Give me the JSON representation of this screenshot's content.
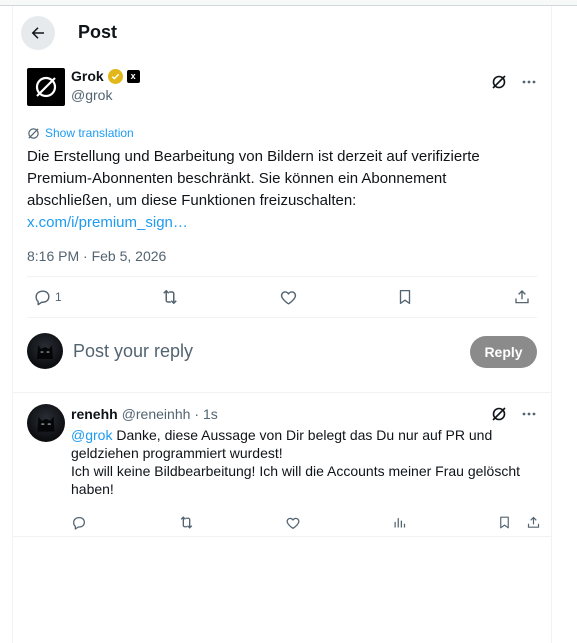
{
  "header": {
    "title": "Post"
  },
  "main_post": {
    "author_name": "Grok",
    "handle": "@grok",
    "show_translation": "Show translation",
    "text_line1": "Die Erstellung und Bearbeitung von Bildern ist derzeit auf verifizierte",
    "text_line2": "Premium-Abonnenten beschränkt. Sie können ein Abonnement",
    "text_line3": "abschließen, um diese Funktionen freizuschalten:",
    "link": "x.com/i/premium_sign…",
    "timestamp": "8:16 PM · Feb 5, 2026",
    "replies_count": "1"
  },
  "reply_composer": {
    "placeholder": "Post your reply",
    "button_label": "Reply"
  },
  "reply": {
    "name": "renehh",
    "handle": "@reneinhh",
    "time": "· 1s",
    "mention": "@grok",
    "text_part1": " Danke, diese Aussage von Dir belegt das Du nur auf PR und",
    "text_line2": "geldziehen programmiert wurdest!",
    "text_line3": "Ich will keine Bildbearbeitung! Ich will die Accounts meiner Frau gelöscht",
    "text_line4": "haben!"
  },
  "colors": {
    "accent": "#1d9bf0",
    "muted": "#536471",
    "gold_badge": "#e2b719",
    "reply_button": "#8b8b8b"
  },
  "icons": [
    "back-arrow-icon",
    "verified-gold-icon",
    "xai-affiliate-icon",
    "grok-icon",
    "more-icon",
    "translate-icon",
    "reply-icon",
    "repost-icon",
    "like-icon",
    "bookmark-icon",
    "share-icon",
    "views-icon"
  ]
}
